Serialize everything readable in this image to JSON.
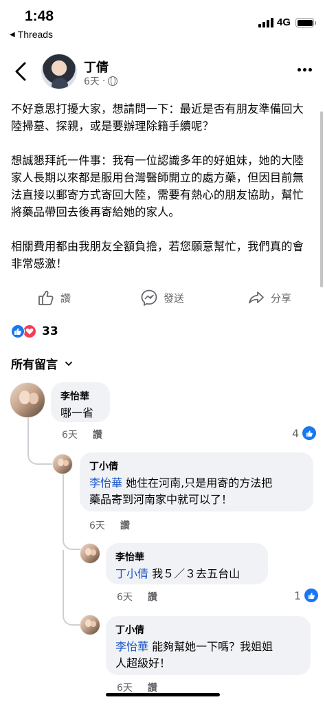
{
  "status_bar": {
    "time": "1:48",
    "back_app": "Threads",
    "network": "4G"
  },
  "header": {
    "author": "丁倩",
    "time": "6天",
    "icons": [
      "back-chevron-icon",
      "globe-icon",
      "more-icon"
    ]
  },
  "post": {
    "paragraphs": [
      "不好意思打擾大家，想請問一下：最近是否有朋友準備回大陸掃墓、探親，或是要辦理除籍手續呢？",
      "想誠懇拜託一件事：我有一位認識多年的好姐妹，她的大陸家人長期以來都是服用台灣醫師開立的處方藥，但因目前無法直接以郵寄方式寄回大陸，需要有熱心的朋友協助，幫忙將藥品帶回去後再寄給她的家人。",
      "相關費用都由我朋友全額負擔，若您願意幫忙，我們真的會非常感激！"
    ]
  },
  "actions": {
    "like": "讚",
    "send": "發送",
    "share": "分享"
  },
  "reactions": {
    "count": "33",
    "icons": [
      "like-reaction-icon",
      "love-reaction-icon"
    ]
  },
  "comments_filter": "所有留言",
  "comments": [
    {
      "name": "李怡華",
      "text": "哪一省",
      "time": "6天",
      "reply": "讚",
      "likes": "4"
    },
    {
      "name": "丁小倩",
      "mention": "李怡華",
      "text_line1": " 她住在河南,只是用寄的方法把",
      "text_line2": "藥品寄到河南家中就可以了！",
      "time": "6天",
      "reply": "讚"
    },
    {
      "name": "李怡華",
      "mention": "丁小倩",
      "text": " 我５／３去五台山",
      "time": "6天",
      "reply": "讚",
      "likes": "1"
    },
    {
      "name": "丁小倩",
      "mention": "李怡華",
      "text_line1": " 能夠幫她一下嗎？我姐姐",
      "text_line2": "人超級好！",
      "time": "6天",
      "reply": "讚"
    }
  ],
  "colors": {
    "mention": "#1a56c6",
    "like_blue": "#1877f2",
    "love_red": "#f33e58",
    "bubble_bg": "#f0f2f5",
    "meta_gray": "#65676b"
  }
}
